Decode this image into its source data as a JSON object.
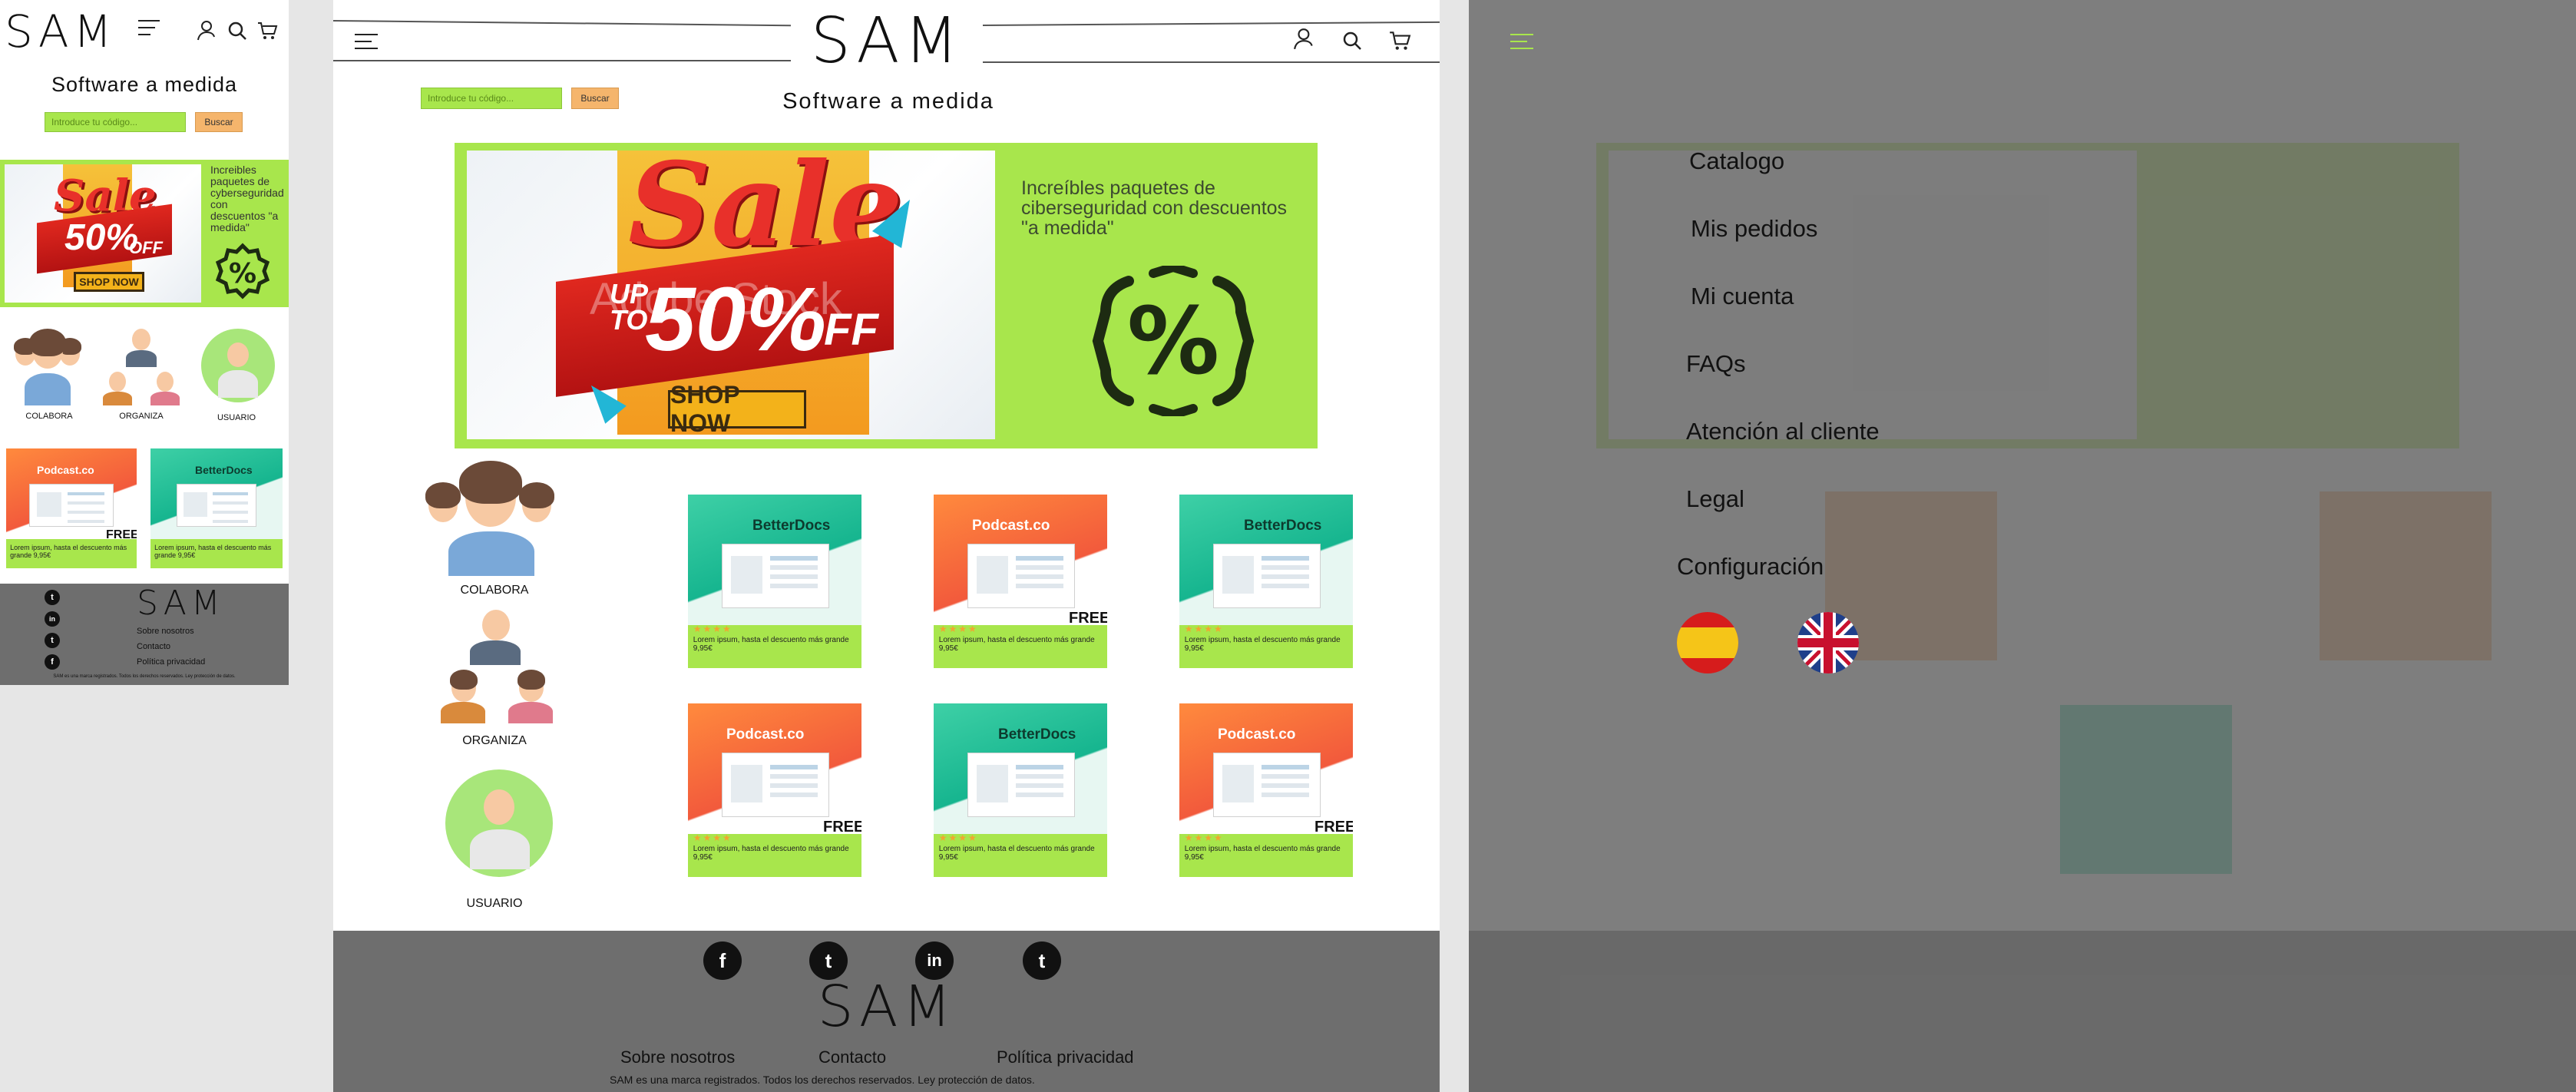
{
  "brand": {
    "logo": "SAM",
    "tagline": "Software a medida"
  },
  "search": {
    "placeholder": "Introduce tu código...",
    "button": "Buscar"
  },
  "banner": {
    "sale_word": "Sale",
    "up_to": "UP TO",
    "percent": "50%",
    "off": "OFF",
    "shop_now": "SHOP NOW",
    "watermark": "Adobe Stock",
    "text": "Increíbles paquetes de ciberseguridad con descuentos \"a medida\"",
    "text_mobile": "Increibles paquetes de cyberseguridad con descuentos \"a medida\"",
    "percent_symbol": "%"
  },
  "features": [
    {
      "label": "COLABORA",
      "icon": "group-icon"
    },
    {
      "label": "ORGANIZA",
      "icon": "network-icon"
    },
    {
      "label": "USUARIO",
      "icon": "user-icon"
    }
  ],
  "products": [
    {
      "brand": "BetterDocs",
      "stars": "★★★★",
      "desc": "Lorem ipsum, hasta el descuento más grande",
      "price": "9,95€",
      "free": ""
    },
    {
      "brand": "Podcast.co",
      "stars": "★★★★",
      "desc": "Lorem ipsum, hasta el descuento más grande",
      "price": "9,95€",
      "free": "FREE"
    },
    {
      "brand": "BetterDocs",
      "stars": "★★★★",
      "desc": "Lorem ipsum, hasta el descuento más grande",
      "price": "9,95€",
      "free": ""
    },
    {
      "brand": "Podcast.co",
      "stars": "★★★★",
      "desc": "Lorem ipsum, hasta el descuento más grande",
      "price": "9,95€",
      "free": "FREE"
    },
    {
      "brand": "BetterDocs",
      "stars": "★★★★",
      "desc": "Lorem ipsum, hasta el descuento más grande",
      "price": "9,95€",
      "free": ""
    },
    {
      "brand": "Podcast.co",
      "stars": "★★★★",
      "desc": "Lorem ipsum, hasta el descuento más grande",
      "price": "9,95€",
      "free": "FREE"
    }
  ],
  "mobile_products": [
    {
      "brand": "Podcast.co",
      "desc": "Lorem ipsum, hasta el descuento más grande",
      "price": "9,95€",
      "free": "FREE"
    },
    {
      "brand": "BetterDocs",
      "desc": "Lorem ipsum, hasta el descuento más grande",
      "price": "9,95€",
      "free": ""
    }
  ],
  "footer": {
    "links": [
      "Sobre nosotros",
      "Contacto",
      "Política privacidad"
    ],
    "legal": "SAM es una marca registrados. Todos los derechos reservados. Ley protección de datos.",
    "social": [
      "f",
      "t",
      "in",
      "t"
    ]
  },
  "menu": {
    "items": [
      "Catalogo",
      "Mis pedidos",
      "Mi cuenta",
      "FAQs",
      "Atención al cliente",
      "Legal",
      "Configuración"
    ],
    "languages": [
      "es",
      "en"
    ]
  },
  "colors": {
    "accent": "#a8e64c",
    "button": "#f5b56c",
    "footer": "#6e6e6e",
    "overlay": "#696969"
  }
}
